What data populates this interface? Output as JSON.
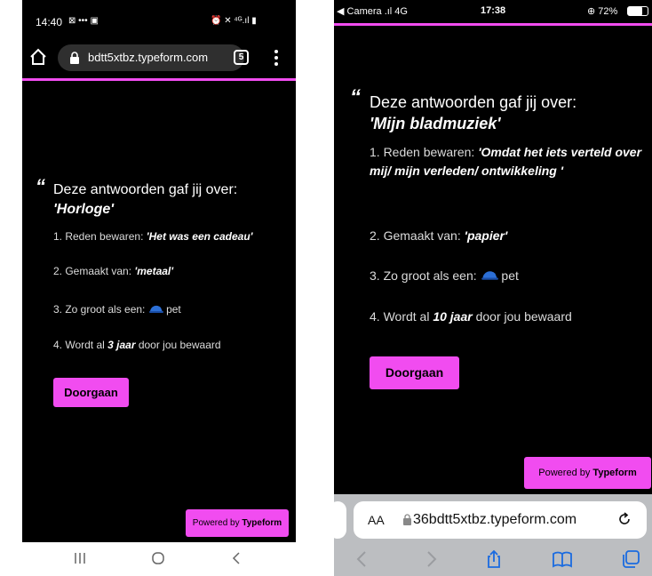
{
  "left": {
    "status": {
      "time": "14:40",
      "icons_left": "⊠ ••• ▣",
      "icons_right": "⏰ ✕ ⁴ᴳ.ıl ▮"
    },
    "toolbar": {
      "url": "bdtt5xtbz.typeform.com",
      "tab_count": "5"
    },
    "quote_mark": "“",
    "heading_text": "Deze antwoorden gaf jij over:",
    "heading_item": "'Horloge'",
    "lines": [
      {
        "label": "1. Reden bewaren: ",
        "value": "'Het was een cadeau'",
        "suffix": ""
      },
      {
        "label": "2. Gemaakt van: ",
        "value": "'metaal'",
        "suffix": ""
      },
      {
        "label": "3. Zo groot als een: ",
        "value": "",
        "suffix": "pet"
      },
      {
        "label": "4. Wordt al ",
        "value": "3 jaar",
        "suffix": " door jou bewaard"
      }
    ],
    "continue_button": "Doorgaan",
    "powered_prefix": "Powered by ",
    "powered_brand": "Typeform",
    "accent": "#f14cf0"
  },
  "right": {
    "status": {
      "left": "◀ Camera .ıl 4G",
      "time": "17:38",
      "battery": "⊕ 72%"
    },
    "quote_mark": "“",
    "heading_text": "Deze antwoorden gaf jij over:",
    "heading_item": "'Mijn bladmuziek'",
    "lines": [
      {
        "label": "1. Reden bewaren: ",
        "value": "'Omdat het iets verteld over mij/ mijn verleden/ ontwikkeling '",
        "suffix": ""
      },
      {
        "label": "2. Gemaakt van: ",
        "value": "'papier'",
        "suffix": ""
      },
      {
        "label": "3. Zo groot als een: ",
        "value": "",
        "suffix": "pet"
      },
      {
        "label": "4. Wordt al ",
        "value": "10 jaar",
        "suffix": " door jou bewaard"
      }
    ],
    "continue_button": "Doorgaan",
    "powered_prefix": "Powered by ",
    "powered_brand": "Typeform",
    "address_bar": {
      "aa": "AA",
      "url": "36bdtt5xtbz.typeform.com"
    }
  }
}
